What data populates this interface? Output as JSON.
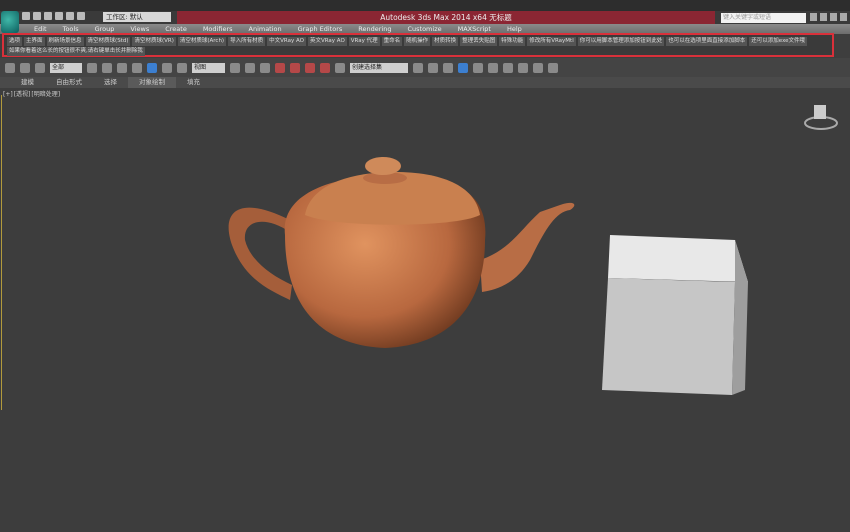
{
  "title_bar": {
    "workspace": "工作区: 默认",
    "title": "Autodesk 3ds Max 2014 x64    无标题",
    "search_placeholder": "键入关键字或短语"
  },
  "menu": [
    "Edit",
    "Tools",
    "Group",
    "Views",
    "Create",
    "Modifiers",
    "Animation",
    "Graph Editors",
    "Rendering",
    "Customize",
    "MAXScript",
    "Help"
  ],
  "custom_toolbar": {
    "row1": [
      "选项",
      "主界面",
      "刷新场景信息",
      "清空材质球(Std)",
      "清空材质球(VR)",
      "清空材质球(Arch)",
      "导入所有材质",
      "中文VRay AO",
      "英文VRay AO",
      "VRay 代理",
      "重命名",
      "随机操作",
      "材质转换",
      "整理丢失贴图",
      "特殊功能",
      "修改所有VRayMtl",
      "你可以用脚本管理添加按钮到此处",
      "也可以在选项里面直接添加脚本",
      "还可以添加exe文件哦"
    ],
    "row2": [
      "如果你看着这么长的按钮很不爽,请右键单击长并删除我"
    ]
  },
  "main_toolbar": {
    "selection_filter": "全部",
    "reference_coord": "视图",
    "named_selection": "创建选择集"
  },
  "ribbon_tabs": [
    {
      "label": "建模"
    },
    {
      "label": "自由形式"
    },
    {
      "label": "选择"
    },
    {
      "label": "对象绘制",
      "active": true
    },
    {
      "label": "填充"
    }
  ],
  "viewport": {
    "labels": [
      "[+]",
      "[透视]",
      "[明暗处理]"
    ]
  },
  "colors": {
    "title_accent": "#8b2633",
    "highlight_box": "#d9303a",
    "teapot": "#c8794f",
    "box": "#cfcfcf"
  }
}
